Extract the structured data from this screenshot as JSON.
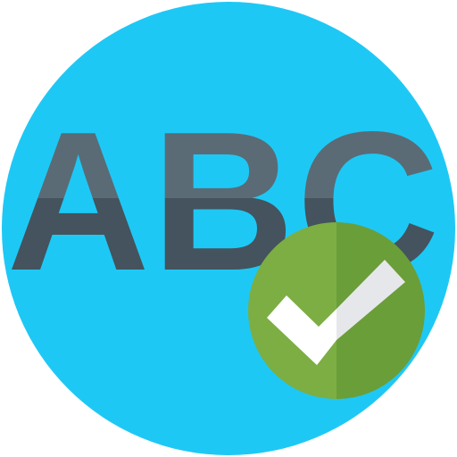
{
  "icon": {
    "name": "spell-check-icon",
    "glyph_text": "ABC",
    "colors": {
      "background": "#ffffff",
      "circle": "#1ec8f5",
      "letters_light": "#5a6b75",
      "letters_dark": "#44535d",
      "badge_light": "#7cae43",
      "badge_dark": "#6a9e38",
      "check_light": "#ffffff",
      "check_dark": "#e6e7ea"
    }
  }
}
